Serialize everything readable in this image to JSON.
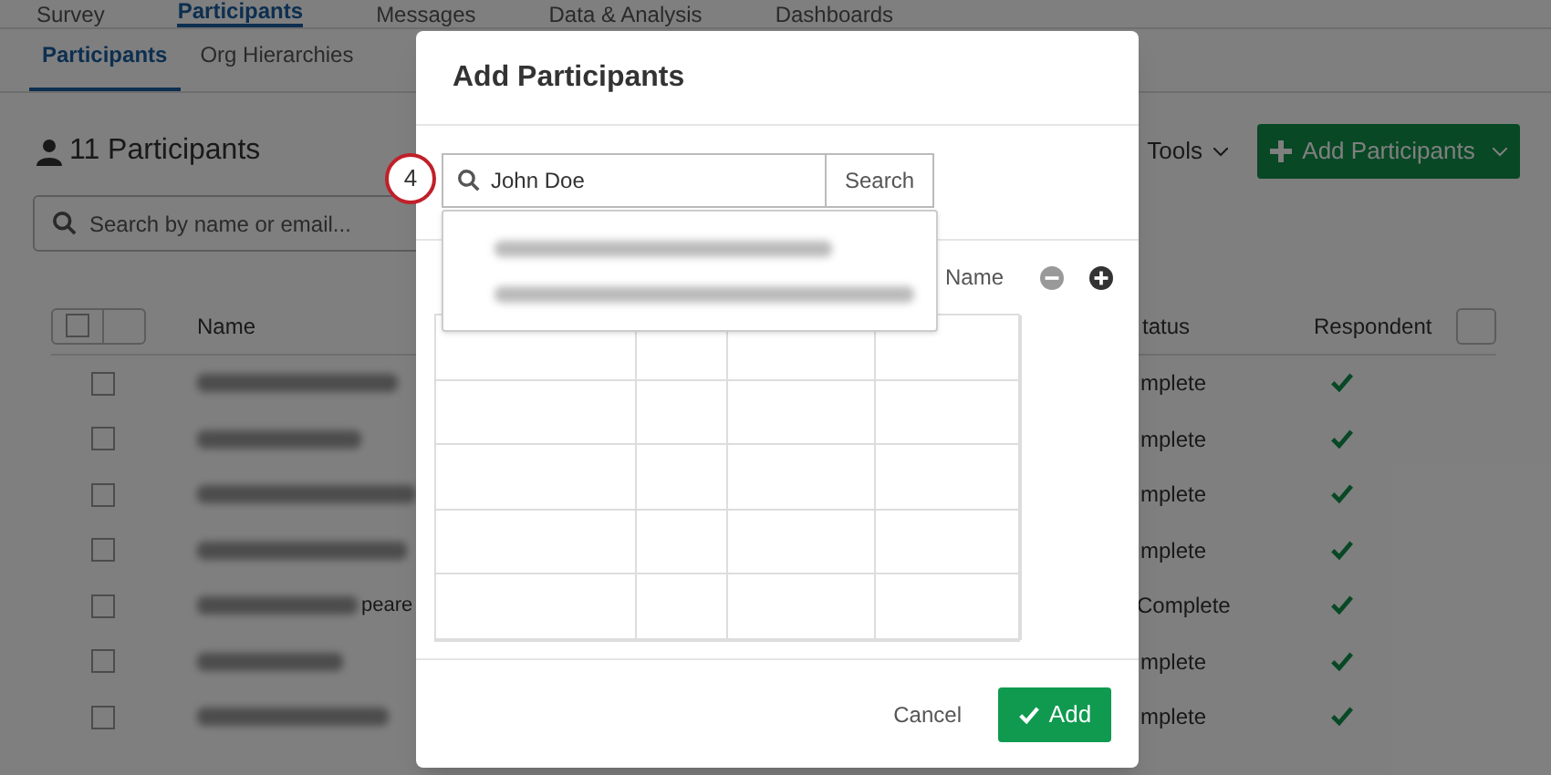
{
  "top_tabs": [
    {
      "label": "Survey",
      "selected": false
    },
    {
      "label": "Participants",
      "selected": true
    },
    {
      "label": "Messages",
      "selected": false
    },
    {
      "label": "Data & Analysis",
      "selected": false
    },
    {
      "label": "Dashboards",
      "selected": false
    }
  ],
  "sub_tabs": [
    {
      "label": "Participants",
      "selected": true
    },
    {
      "label": "Org Hierarchies",
      "selected": false
    }
  ],
  "count": "11 Participants",
  "search": {
    "placeholder": "Search by name or email..."
  },
  "tools": "Tools",
  "add_button": "Add Participants",
  "select_all": {
    "checked": false
  },
  "table": {
    "columns": [
      "Name",
      "tatus",
      "Respondent"
    ],
    "rows": [
      {
        "checked": false,
        "name_fragment": "",
        "status": "mplete",
        "responded": true
      },
      {
        "checked": false,
        "name_fragment": "",
        "status": "mplete",
        "responded": true
      },
      {
        "checked": false,
        "name_fragment": "",
        "status": "mplete",
        "responded": true
      },
      {
        "checked": false,
        "name_fragment": "",
        "status": "mplete",
        "responded": true
      },
      {
        "checked": false,
        "name_fragment": "peare",
        "status": "Complete",
        "responded": true
      },
      {
        "checked": false,
        "name_fragment": "",
        "status": "mplete",
        "responded": true
      },
      {
        "checked": false,
        "name_fragment": "",
        "status": "mplete",
        "responded": true
      }
    ]
  },
  "modal": {
    "title": "Add Participants",
    "step": "4",
    "search_value": "John Doe",
    "search_button": "Search",
    "column_label": "Name",
    "cancel": "Cancel",
    "add": "Add"
  }
}
